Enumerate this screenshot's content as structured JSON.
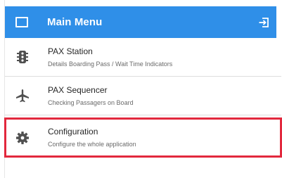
{
  "header": {
    "title": "Main Menu",
    "color": "#2f8fe8",
    "menu_icon": "window-icon",
    "exit_icon": "exit-icon"
  },
  "menu": {
    "items": [
      {
        "title": "PAX Station",
        "subtitle": "Details Boarding Pass / Wait Time Indicators",
        "icon": "traffic-light-icon"
      },
      {
        "title": "PAX Sequencer",
        "subtitle": "Checking Passagers on Board",
        "icon": "airplane-icon"
      },
      {
        "title": "Configuration",
        "subtitle": "Configure the whole application",
        "icon": "gear-icon",
        "highlighted": true
      }
    ]
  },
  "highlight_color": "#e2283d"
}
